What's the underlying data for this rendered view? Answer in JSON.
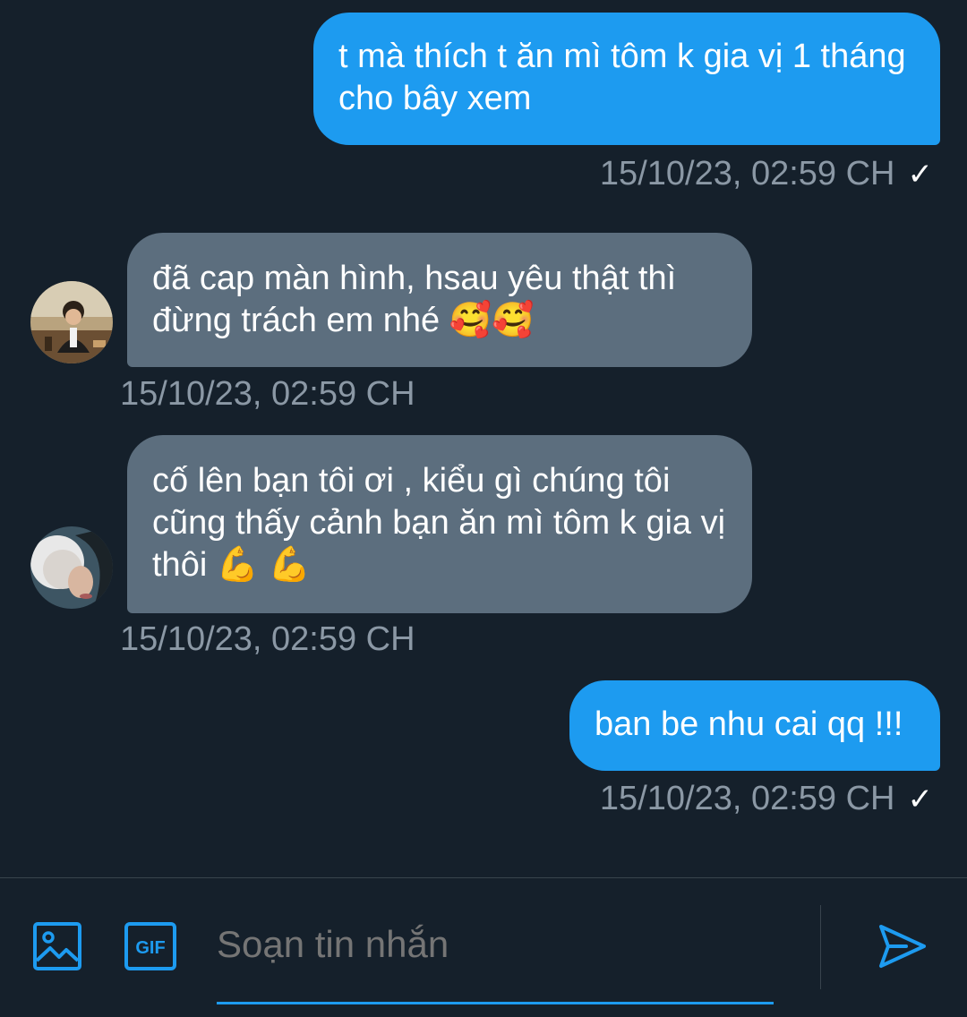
{
  "colors": {
    "background": "#15202b",
    "outgoing_bubble": "#1d9bf0",
    "incoming_bubble": "#5c6e7e",
    "timestamp": "#8b98a5",
    "accent": "#1d9bf0"
  },
  "messages": [
    {
      "direction": "outgoing",
      "text": "t mà thích t ăn mì tôm k gia vị 1 tháng cho bây xem",
      "timestamp": "15/10/23, 02:59 CH",
      "status": "✓"
    },
    {
      "direction": "incoming",
      "avatar": "avatar-photo-1",
      "text": "đã cap màn hình, hsau yêu thật thì đừng trách em nhé 🥰🥰",
      "timestamp": "15/10/23, 02:59 CH"
    },
    {
      "direction": "incoming",
      "avatar": "avatar-photo-2",
      "text": "cố lên bạn tôi ơi , kiểu gì chúng tôi cũng thấy cảnh bạn ăn mì tôm k gia vị thôi 💪 💪",
      "timestamp": "15/10/23, 02:59 CH"
    },
    {
      "direction": "outgoing",
      "text": "ban be nhu cai qq !!!",
      "timestamp": "15/10/23, 02:59 CH",
      "status": "✓"
    }
  ],
  "composer": {
    "placeholder": "Soạn tin nhắn",
    "image_icon": "image-icon",
    "gif_label": "GIF",
    "send_icon": "send-icon"
  }
}
